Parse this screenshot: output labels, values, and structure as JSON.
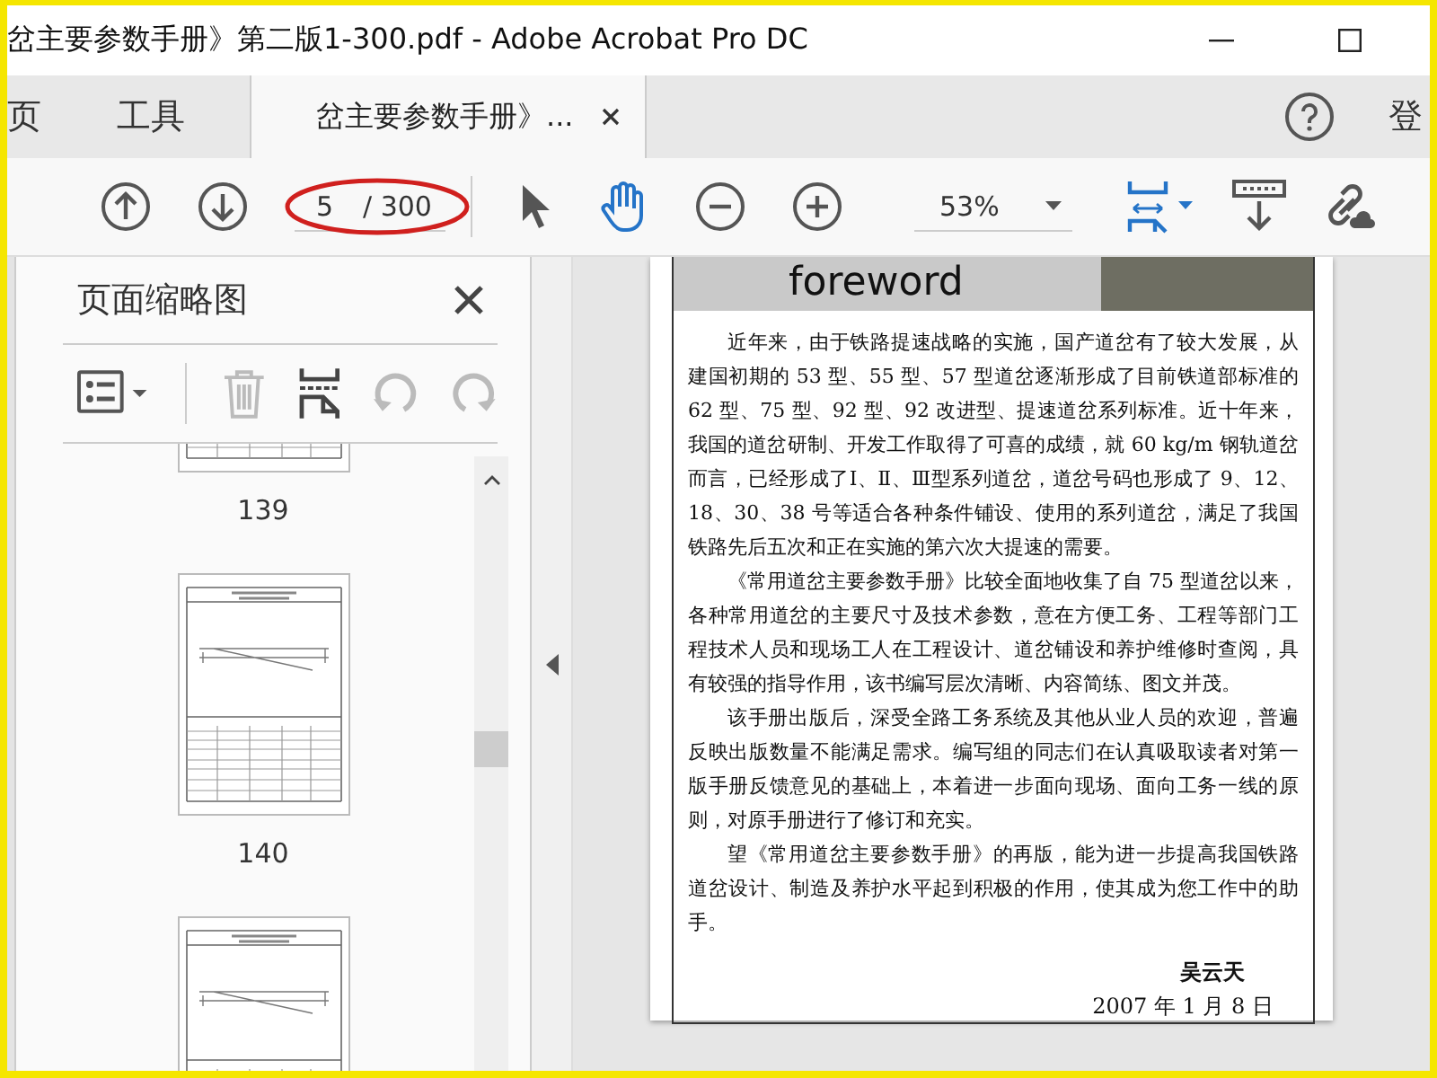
{
  "window": {
    "title": "岔主要参数手册》第二版1-300.pdf - Adobe Acrobat Pro DC"
  },
  "tabs": [
    {
      "label": "页",
      "selected": false,
      "closable": false
    },
    {
      "label": "工具",
      "selected": false,
      "closable": false
    },
    {
      "label": "岔主要参数手册》...",
      "selected": true,
      "closable": true
    }
  ],
  "sign_in": "登",
  "toolbar": {
    "page_number": "5",
    "page_total": "/ 300",
    "zoom": "53%"
  },
  "thumbnails_panel": {
    "title": "页面缩略图",
    "thumbnails": [
      {
        "label": "139",
        "kind": "cut"
      },
      {
        "label": "140",
        "kind": "full"
      },
      {
        "kind": "full"
      }
    ]
  },
  "document": {
    "heading": "foreword",
    "paragraphs": [
      "近年来，由于铁路提速战略的实施，国产道岔有了较大发展，从建国初期的 53 型、55 型、57 型道岔逐渐形成了目前铁道部标准的 62 型、75 型、92 型、92 改进型、提速道岔系列标准。近十年来，我国的道岔研制、开发工作取得了可喜的成绩，就 60 kg/m 钢轨道岔而言，已经形成了Ⅰ、Ⅱ、Ⅲ型系列道岔，道岔号码也形成了 9、12、18、30、38 号等适合各种条件铺设、使用的系列道岔，满足了我国铁路先后五次和正在实施的第六次大提速的需要。",
      "《常用道岔主要参数手册》比较全面地收集了自 75 型道岔以来，各种常用道岔的主要尺寸及技术参数，意在方便工务、工程等部门工程技术人员和现场工人在工程设计、道岔铺设和养护维修时查阅，具有较强的指导作用，该书编写层次清晰、内容简练、图文并茂。",
      "该手册出版后，深受全路工务系统及其他从业人员的欢迎，普遍反映出版数量不能满足需求。编写组的同志们在认真吸取读者对第一版手册反馈意见的基础上，本着进一步面向现场、面向工务一线的原则，对原手册进行了修订和充实。",
      "望《常用道岔主要参数手册》的再版，能为进一步提高我国铁路道岔设计、制造及养护水平起到积极的作用，使其成为您工作中的助手。"
    ],
    "signature": "吴云天",
    "date": "2007 年 1 月 8 日"
  }
}
